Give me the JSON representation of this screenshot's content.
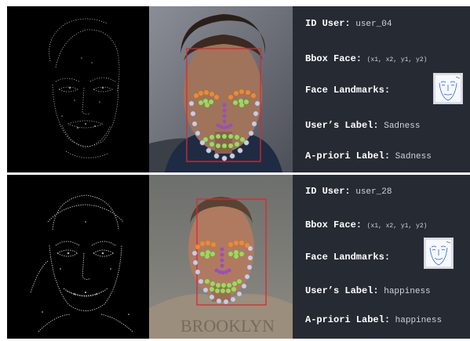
{
  "samples": [
    {
      "id_user": {
        "key": "ID User:",
        "value": "user_04"
      },
      "bbox_face": {
        "key": "Bbox Face:",
        "value": "(x1, x2, y1, y2)"
      },
      "face_landmarks": {
        "key": "Face Landmarks:"
      },
      "users_label": {
        "key": "User’s Label:",
        "value": "Sadness"
      },
      "apriori_label": {
        "key": "A-priori Label:",
        "value": "Sadness"
      }
    },
    {
      "id_user": {
        "key": "ID User:",
        "value": "user_28"
      },
      "bbox_face": {
        "key": "Bbox Face:",
        "value": "(x1, x2, y1, y2)"
      },
      "face_landmarks": {
        "key": "Face Landmarks:"
      },
      "users_label": {
        "key": "User’s Label:",
        "value": "happiness"
      },
      "apriori_label": {
        "key": "A-priori Label:",
        "value": "happiness"
      },
      "shirt_text": "BROOKLYN"
    }
  ],
  "colors": {
    "info_background": "#262a33",
    "bbox": "#e0262b",
    "eyebrow_landmarks": "#f08a2c",
    "eye_mouth_landmarks": "#8fe05a",
    "nose_landmarks": "#9b4fb8",
    "jaw_landmarks": "#c9cde3"
  }
}
